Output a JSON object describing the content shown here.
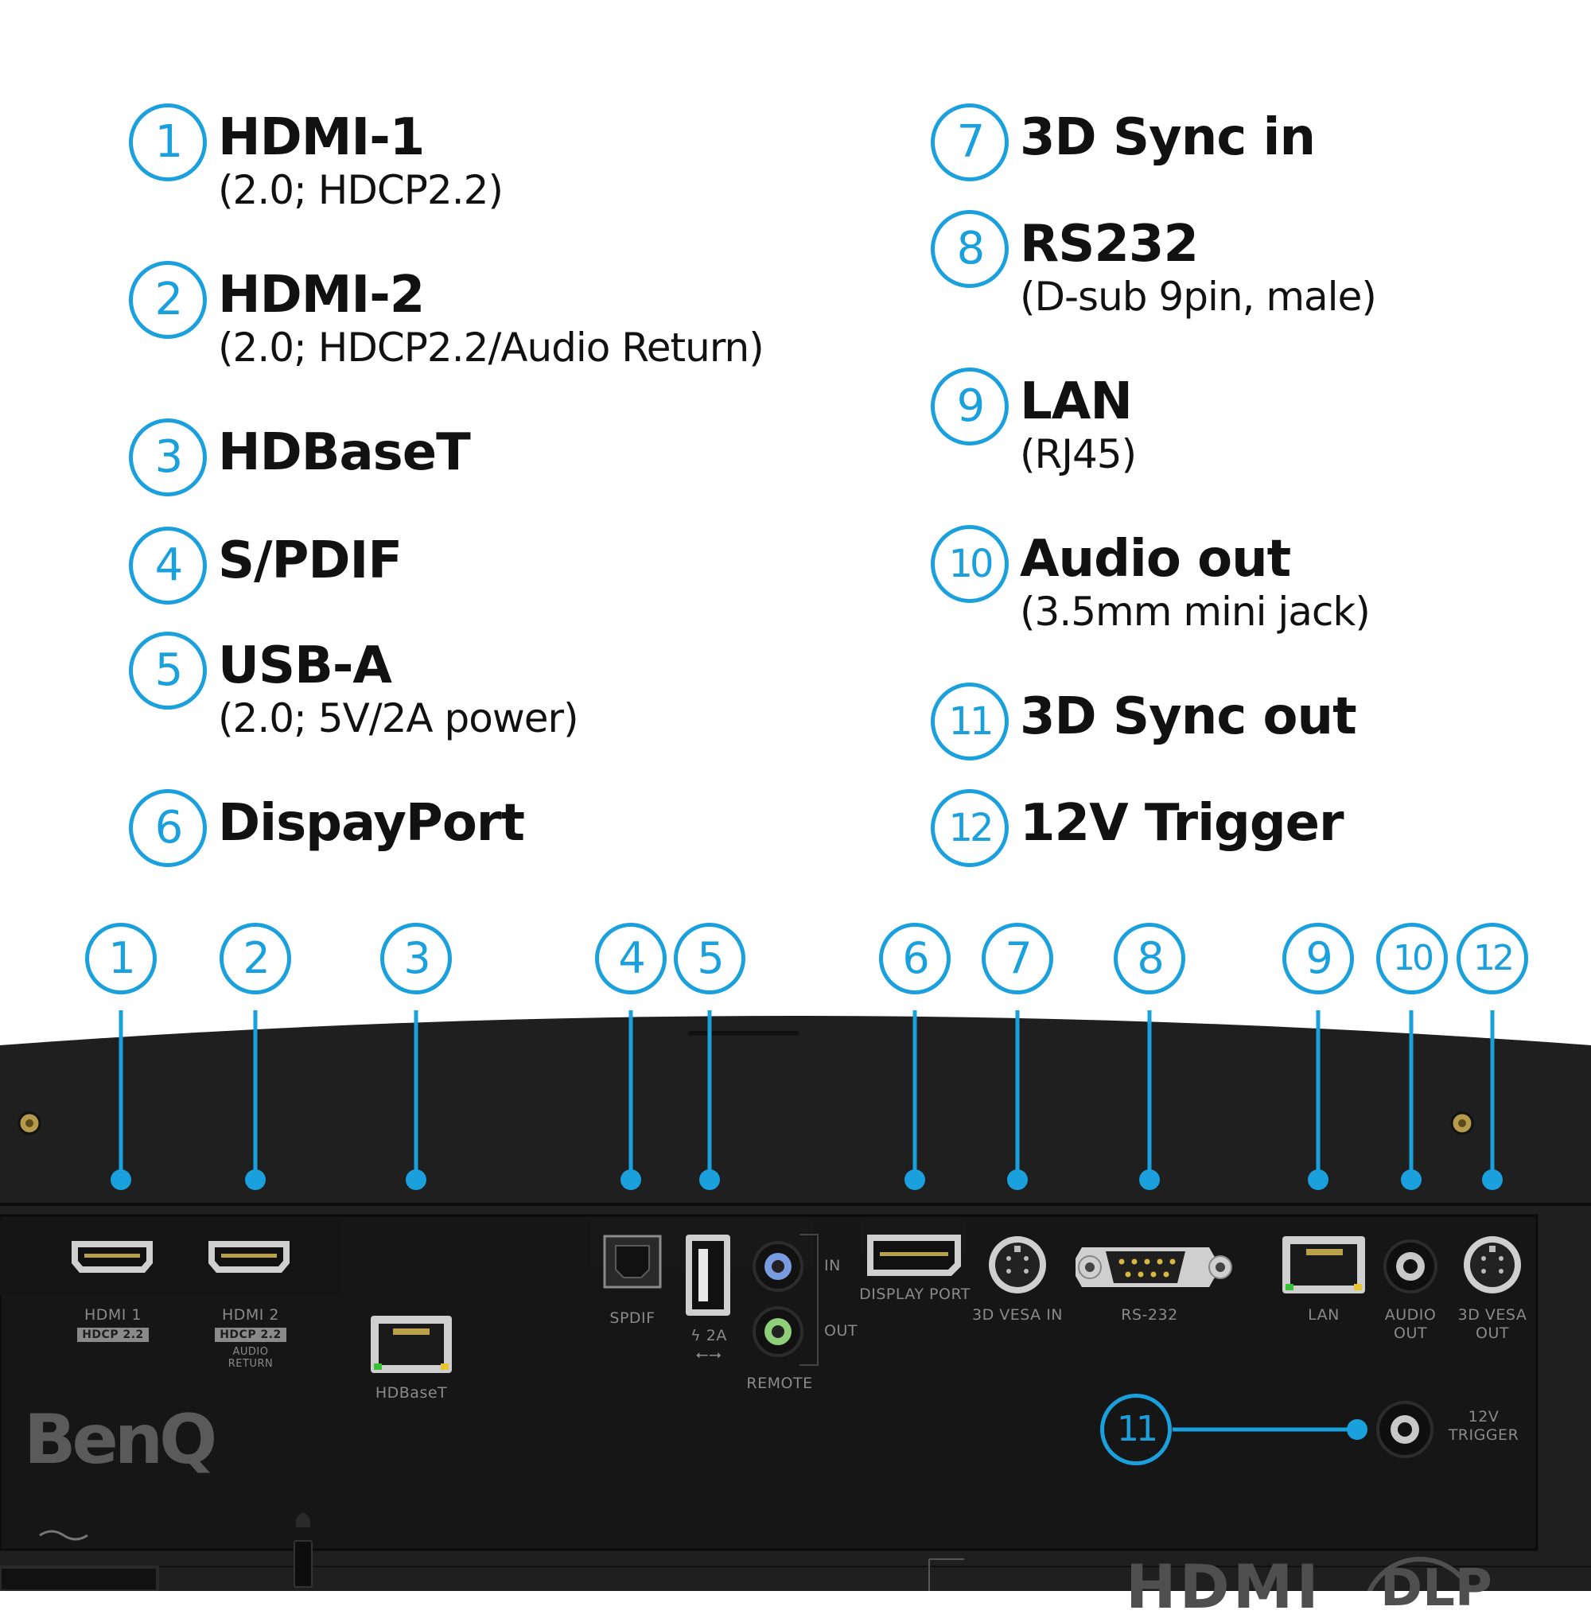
{
  "legend": [
    {
      "num": "1",
      "title": "HDMI-1",
      "sub": "(2.0; HDCP2.2)"
    },
    {
      "num": "2",
      "title": "HDMI-2",
      "sub": "(2.0; HDCP2.2/Audio Return)"
    },
    {
      "num": "3",
      "title": "HDBaseT",
      "sub": ""
    },
    {
      "num": "4",
      "title": "S/PDIF",
      "sub": ""
    },
    {
      "num": "5",
      "title": "USB-A",
      "sub": "(2.0; 5V/2A power)"
    },
    {
      "num": "6",
      "title": "DispayPort",
      "sub": ""
    },
    {
      "num": "7",
      "title": "3D Sync in",
      "sub": ""
    },
    {
      "num": "8",
      "title": "RS232",
      "sub": "(D-sub 9pin, male)"
    },
    {
      "num": "9",
      "title": "LAN",
      "sub": "(RJ45)"
    },
    {
      "num": "10",
      "title": "Audio out",
      "sub": "(3.5mm mini jack)"
    },
    {
      "num": "11",
      "title": "3D Sync out",
      "sub": ""
    },
    {
      "num": "12",
      "title": "12V Trigger",
      "sub": ""
    }
  ],
  "callouts": [
    "1",
    "2",
    "3",
    "4",
    "5",
    "6",
    "7",
    "8",
    "9",
    "10",
    "12",
    "11"
  ],
  "panel_labels": {
    "hdmi1": "HDMI 1",
    "hdmi1_badge": "HDCP 2.2",
    "hdmi2": "HDMI 2",
    "hdmi2_badge": "HDCP 2.2",
    "hdmi2_audio": "AUDIO",
    "hdmi2_return": "RETURN",
    "hdbaset": "HDBaseT",
    "spdif": "SPDIF",
    "usb_power": "2A",
    "remote_in": "IN",
    "remote_out": "OUT",
    "remote": "REMOTE",
    "displayport": "DISPLAY PORT",
    "vesa_in": "3D VESA IN",
    "rs232": "RS-232",
    "lan": "LAN",
    "audio_out_1": "AUDIO",
    "audio_out_2": "OUT",
    "vesa_out_1": "3D VESA",
    "vesa_out_2": "OUT",
    "trigger_1": "12V",
    "trigger_2": "TRIGGER"
  },
  "brand": "BenQ",
  "hdmi_logo": "HDMI",
  "dlp_logo": "DLP",
  "colors": {
    "accent": "#1aa0dc",
    "panel": "#1e1e1e",
    "port_label": "#8a8a8a"
  }
}
